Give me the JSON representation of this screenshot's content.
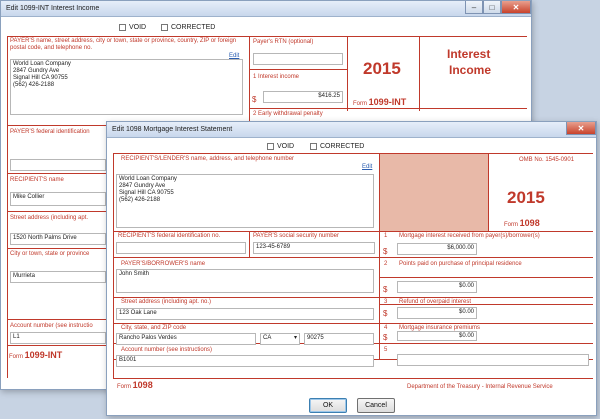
{
  "win1": {
    "title": "Edit 1099-INT Interest Income",
    "void_label": "VOID",
    "corrected_label": "CORRECTED",
    "payer_name_label": "PAYER'S name, street address, city or town, state or province, country, ZIP or foreign postal code, and telephone no.",
    "edit_link": "Edit",
    "payer_address": [
      "World Loan Company",
      "2847 Gundry Ave",
      "Signal Hill CA 90755",
      "(562) 426-2188"
    ],
    "rtn_label": "Payer's RTN (optional)",
    "year": "2015",
    "form_title_1": "Interest",
    "form_title_2": "Income",
    "box1_label": "1 Interest income",
    "box1_currency": "$",
    "box1_value": "$416.25",
    "form_prefix": "Form",
    "form_name": "1099-INT",
    "box2_label": "2 Early withdrawal penalty",
    "payer_fed_label": "PAYER'S federal identification",
    "recipient_name_label": "RECIPIENT'S name",
    "recipient_name": "Mike Collier",
    "street_label": "Street address (including apt.",
    "street_value": "1520 North Palms Drive",
    "city_label": "City or town, state or province",
    "city_value": "Murrieta",
    "account_label": "Account number (see instructio",
    "account_value": "L1",
    "footer_form_prefix": "Form",
    "footer_form_name": "1099-INT"
  },
  "win2": {
    "title": "Edit 1098 Mortgage Interest Statement",
    "void_label": "VOID",
    "corrected_label": "CORRECTED",
    "lender_label": "RECIPIENT'S/LENDER'S name, address, and telephone number",
    "edit_link": "Edit",
    "lender_address": [
      "World Loan Company",
      "2847 Gundry Ave",
      "Signal Hill CA 90755",
      "(562) 426-2188"
    ],
    "omb": "OMB No. 1545-0901",
    "year": "2015",
    "form_prefix": "Form",
    "form_name": "1098",
    "recipient_fed_label": "RECIPIENT'S federal identification no.",
    "payer_ssn_label": "PAYER'S social security number",
    "payer_ssn": "123-45-6789",
    "box1_num": "1",
    "box1_label": "Mortgage interest received from payer(s)/borrower(s)",
    "box1_currency": "$",
    "box1_value": "$6,000.00",
    "borrower_label": "PAYER'S/BORROWER'S name",
    "borrower_name": "John Smith",
    "box2_num": "2",
    "box2_label": "Points paid on purchase of principal residence",
    "box2_currency": "$",
    "box2_value": "$0.00",
    "street_label": "Street address (including apt. no.)",
    "street_value": "123 Oak Lane",
    "box3_num": "3",
    "box3_label": "Refund of overpaid interest",
    "box3_currency": "$",
    "box3_value": "$0.00",
    "city_label": "City, state, and ZIP code",
    "city_value": "Rancho Palos Verdes",
    "state_value": "CA",
    "zip_value": "90275",
    "box4_num": "4",
    "box4_label": "Mortgage insurance premiums",
    "box4_currency": "$",
    "box4_value": "$0.00",
    "account_label": "Account number (see instructions)",
    "account_value": "B1001",
    "box5_num": "5",
    "footer_form_prefix": "Form",
    "footer_form_name": "1098",
    "dept": "Department of the Treasury - Internal Revenue Service",
    "ok_label": "OK",
    "cancel_label": "Cancel"
  },
  "colors": {
    "form_red": "#c0392b",
    "shaded": "#e8b9a8",
    "link": "#2a5db0"
  }
}
